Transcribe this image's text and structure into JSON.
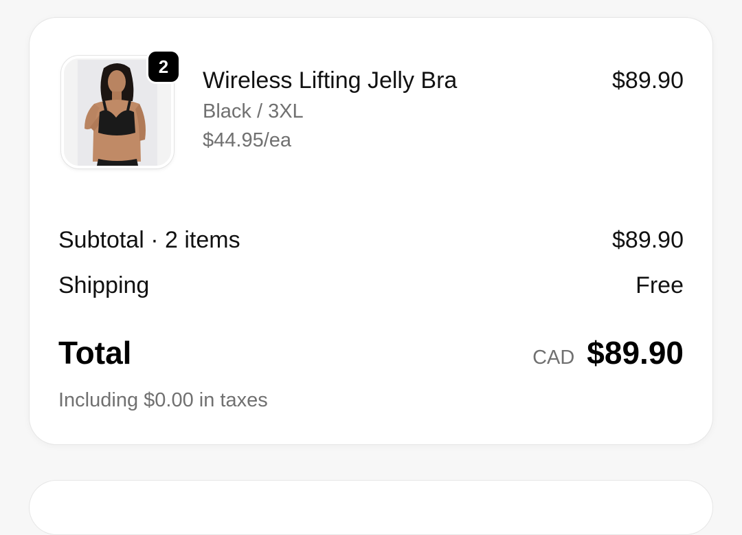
{
  "line_item": {
    "title": "Wireless Lifting Jelly Bra",
    "variant": "Black / 3XL",
    "unit_price": "$44.95/ea",
    "line_price": "$89.90",
    "quantity": "2"
  },
  "summary": {
    "subtotal_label": "Subtotal · 2 items",
    "subtotal_value": "$89.90",
    "shipping_label": "Shipping",
    "shipping_value": "Free",
    "total_label": "Total",
    "currency": "CAD",
    "total_value": "$89.90",
    "tax_note": "Including $0.00 in taxes"
  },
  "colors": {
    "background": "#f7f7f7",
    "card": "#ffffff",
    "primary_text": "#111111",
    "secondary_text": "#707070",
    "badge": "#000000"
  }
}
